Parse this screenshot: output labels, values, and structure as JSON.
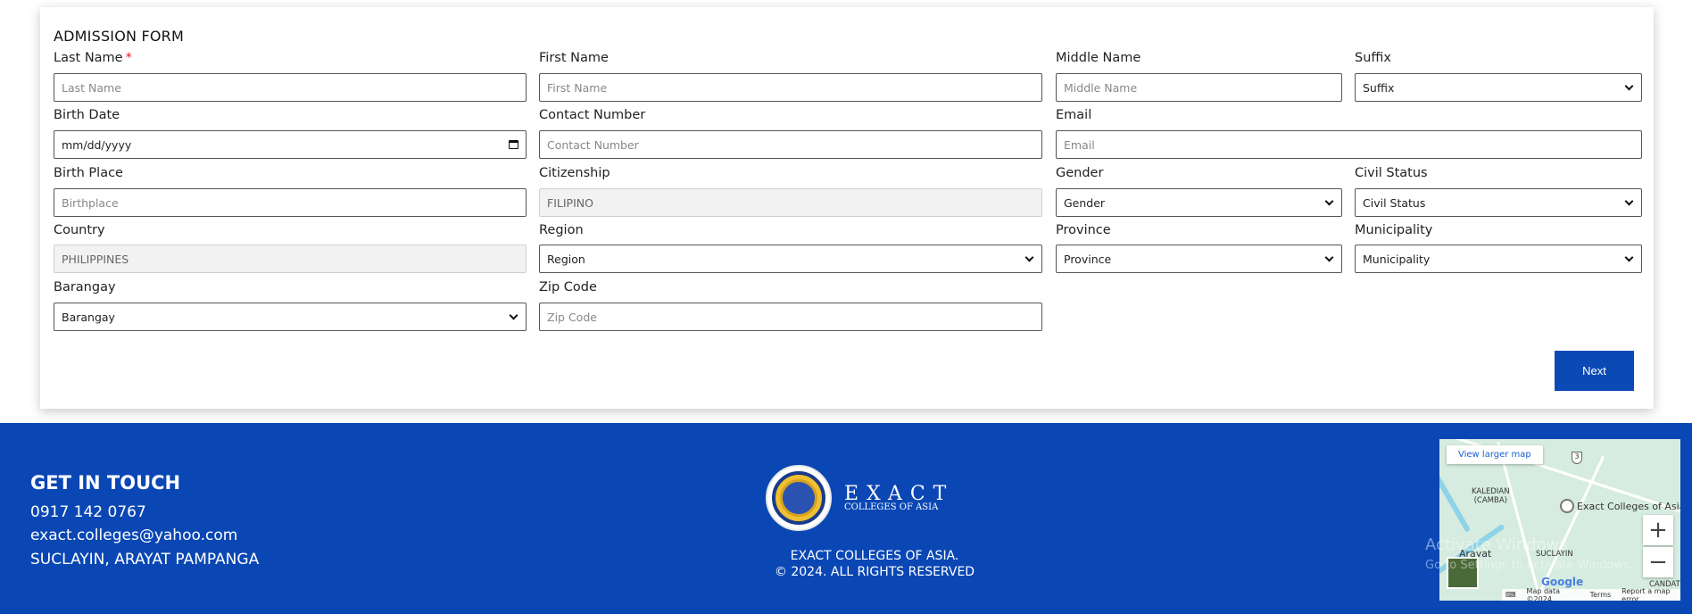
{
  "form": {
    "title": "ADMISSION FORM",
    "required_mark": "*",
    "fields": {
      "last_name": {
        "label": "Last Name",
        "placeholder": "Last Name"
      },
      "first_name": {
        "label": "First Name",
        "placeholder": "First Name"
      },
      "middle_name": {
        "label": "Middle Name",
        "placeholder": "Middle Name"
      },
      "suffix": {
        "label": "Suffix",
        "selected": "Suffix"
      },
      "birth_date": {
        "label": "Birth Date",
        "value": "mm/dd/yyyy"
      },
      "contact_number": {
        "label": "Contact Number",
        "placeholder": "Contact Number"
      },
      "email": {
        "label": "Email",
        "placeholder": "Email"
      },
      "birth_place": {
        "label": "Birth Place",
        "placeholder": "Birthplace"
      },
      "citizenship": {
        "label": "Citizenship",
        "value": "FILIPINO"
      },
      "gender": {
        "label": "Gender",
        "selected": "Gender"
      },
      "civil_status": {
        "label": "Civil Status",
        "selected": "Civil Status"
      },
      "country": {
        "label": "Country",
        "value": "PHILIPPINES"
      },
      "region": {
        "label": "Region",
        "selected": "Region"
      },
      "province": {
        "label": "Province",
        "selected": "Province"
      },
      "municipality": {
        "label": "Municipality",
        "selected": "Municipality"
      },
      "barangay": {
        "label": "Barangay",
        "selected": "Barangay"
      },
      "zip_code": {
        "label": "Zip Code",
        "placeholder": "Zip Code"
      }
    },
    "next_label": "Next"
  },
  "footer": {
    "get_in_touch": "GET IN TOUCH",
    "phone": "0917 142 0767",
    "email": "exact.colleges@yahoo.com",
    "address": "SUCLAYIN, ARAYAT PAMPANGA",
    "logo_word": "EXACT",
    "logo_sub": "COLLEGES OF ASIA",
    "copyright_line1": "EXACT COLLEGES OF ASIA.",
    "copyright_line2": "© 2024. ALL RIGHTS RESERVED"
  },
  "map": {
    "view_larger": "View larger map",
    "place_kaledian": "KALEDIAN\n(CAMBA)",
    "place_exact": "Exact Colleges of Asia",
    "place_suclayin": "SUCLAYIN",
    "place_arayat": "Arayat",
    "place_candati": "CANDATI",
    "route_number": "3",
    "google": "Google",
    "map_data": "Map data ©2024",
    "terms": "Terms",
    "report": "Report a map error",
    "zoom_in": "+",
    "zoom_out": "−"
  },
  "watermark": {
    "line1": "Activate Windows",
    "line2": "Go to Settings to activate Windows."
  },
  "icons": {
    "calendar": "calendar-icon",
    "chevron": "chevron-down-icon"
  },
  "colors": {
    "footer_bg": "#0a47b4",
    "button_bg": "#0b4ab5",
    "required": "#e02020"
  }
}
